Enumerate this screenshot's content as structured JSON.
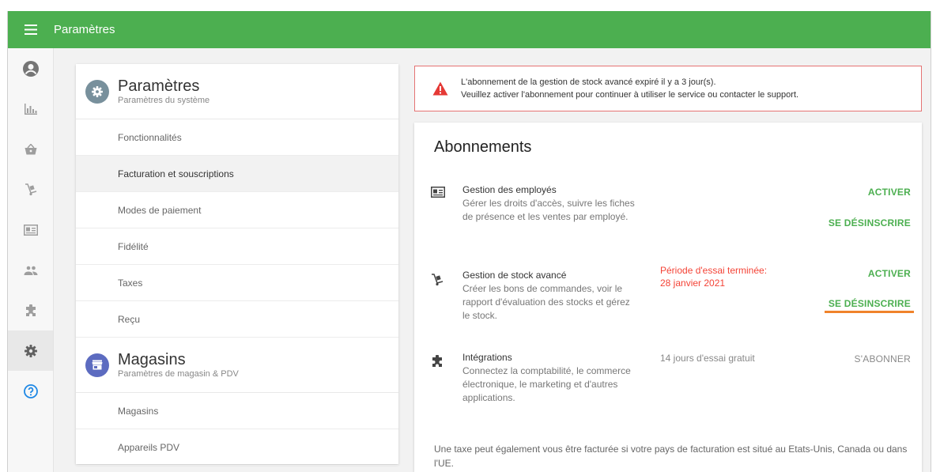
{
  "header": {
    "title": "Paramètres",
    "menu_icon": "hamburger-icon",
    "color": "#4caf50"
  },
  "sidenav": {
    "items": [
      {
        "icon": "account-icon",
        "active": false
      },
      {
        "icon": "reports-chart-icon",
        "active": false
      },
      {
        "icon": "basket-icon",
        "active": false
      },
      {
        "icon": "inventory-cart-icon",
        "active": false
      },
      {
        "icon": "employee-card-icon",
        "active": false
      },
      {
        "icon": "customers-icon",
        "active": false
      },
      {
        "icon": "integrations-puzzle-icon",
        "active": false
      },
      {
        "icon": "settings-gear-icon",
        "active": true
      },
      {
        "icon": "help-icon",
        "active": false
      }
    ]
  },
  "settings": {
    "section1": {
      "title": "Paramètres",
      "subtitle": "Paramètres du système",
      "icon": "gear-icon",
      "items": [
        "Fonctionnalités",
        "Facturation et souscriptions",
        "Modes de paiement",
        "Fidélité",
        "Taxes",
        "Reçu"
      ],
      "active_index": 1
    },
    "section2": {
      "title": "Magasins",
      "subtitle": "Paramètres de magasin & PDV",
      "icon": "store-icon",
      "items": [
        "Magasins",
        "Appareils PDV"
      ]
    }
  },
  "alert": {
    "line1": "L'abonnement de la gestion de stock avancé expiré il y a 3 jour(s).",
    "line2": "Veuillez activer l'abonnement pour continuer à utiliser le service ou contacter le support.",
    "icon": "warning-icon",
    "color": "#e53935"
  },
  "subscriptions": {
    "title": "Abonnements",
    "rows": [
      {
        "name": "Gestion des employés",
        "desc": "Gérer les droits d'accès, suivre les fiches de présence et les ventes par employé.",
        "icon": "employee-card-icon",
        "status": "",
        "actions": [
          "ACTIVER",
          "SE DÉSINSCRIRE"
        ]
      },
      {
        "name": "Gestion de stock avancé",
        "desc": "Créer les bons de commandes, voir le rapport d'évaluation des stocks et gérez le stock.",
        "icon": "inventory-cart-icon",
        "status_line1": "Période d'essai terminée:",
        "status_line2": "28 janvier 2021",
        "actions": [
          "ACTIVER",
          "SE DÉSINSCRIRE"
        ]
      },
      {
        "name": "Intégrations",
        "desc": "Connectez la comptabilité, le commerce électronique, le marketing et d'autres applications.",
        "icon": "puzzle-icon",
        "status": "14 jours d'essai gratuit",
        "actions": [
          "S'ABONNER"
        ]
      }
    ],
    "footnote": "Une taxe peut également vous être facturée si votre pays de facturation est situé au Etats-Unis, Canada ou dans l'UE.",
    "accent_green": "#4caf50",
    "highlight_orange": "#f0832b"
  }
}
